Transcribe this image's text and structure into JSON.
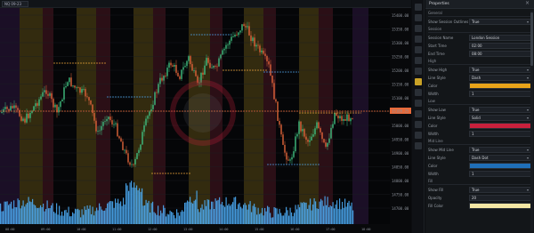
{
  "chart": {
    "symbol_tab": "NQ 09-23",
    "price_ticks": [
      "15400.00",
      "15350.00",
      "15300.00",
      "15250.00",
      "15200.00",
      "15150.00",
      "15100.00",
      "15050.00",
      "15000.00",
      "14950.00",
      "14900.00",
      "14850.00",
      "14800.00",
      "14750.00",
      "14700.00"
    ],
    "current_price": "15109.25",
    "time_ticks": [
      "08:00",
      "09:00",
      "10:00",
      "11:00",
      "12:00",
      "13:00",
      "14:00",
      "15:00",
      "16:00",
      "17:00",
      "18:00"
    ]
  },
  "colors": {
    "bull": "#3fbf7f",
    "bear": "#e0643a",
    "volume": "#4fb3ff",
    "session_amber": "#5a4a15",
    "session_red": "#4a1722",
    "session_purple": "#2d1840",
    "level_line": "#e8a33a"
  },
  "panel": {
    "title": "Properties",
    "sections": [
      {
        "title": "General",
        "rows": [
          {
            "label": "Show Session Outlines",
            "value": "True",
            "type": "select"
          }
        ]
      },
      {
        "title": "Session",
        "rows": [
          {
            "label": "Session Name",
            "value": "London Session",
            "type": "text"
          },
          {
            "label": "Start Time",
            "value": "02:00",
            "type": "text"
          },
          {
            "label": "End Time",
            "value": "08:00",
            "type": "text"
          }
        ]
      },
      {
        "title": "High",
        "rows": [
          {
            "label": "Show High",
            "value": "True",
            "type": "select"
          },
          {
            "label": "Line Style",
            "value": "Dash",
            "type": "select"
          },
          {
            "label": "Color",
            "value": "",
            "type": "swatch",
            "color": "#e8a319"
          },
          {
            "label": "Width",
            "value": "1",
            "type": "text"
          }
        ]
      },
      {
        "title": "Low",
        "rows": [
          {
            "label": "Show Low",
            "value": "True",
            "type": "select"
          },
          {
            "label": "Line Style",
            "value": "Solid",
            "type": "select"
          },
          {
            "label": "Color",
            "value": "",
            "type": "swatch",
            "color": "#c8203c"
          },
          {
            "label": "Width",
            "value": "1",
            "type": "text"
          }
        ]
      },
      {
        "title": "Mid Line",
        "rows": [
          {
            "label": "Show Mid Line",
            "value": "True",
            "type": "select"
          },
          {
            "label": "Line Style",
            "value": "Dash Dot",
            "type": "select"
          },
          {
            "label": "Color",
            "value": "",
            "type": "swatch",
            "color": "#1f6fb8"
          },
          {
            "label": "Width",
            "value": "1",
            "type": "text"
          }
        ]
      },
      {
        "title": "Fill",
        "rows": [
          {
            "label": "Show Fill",
            "value": "True",
            "type": "select"
          },
          {
            "label": "Opacity",
            "value": "20",
            "type": "text"
          },
          {
            "label": "Fill Color",
            "value": "",
            "type": "swatch",
            "color": "#f4e7a4"
          }
        ]
      }
    ]
  }
}
